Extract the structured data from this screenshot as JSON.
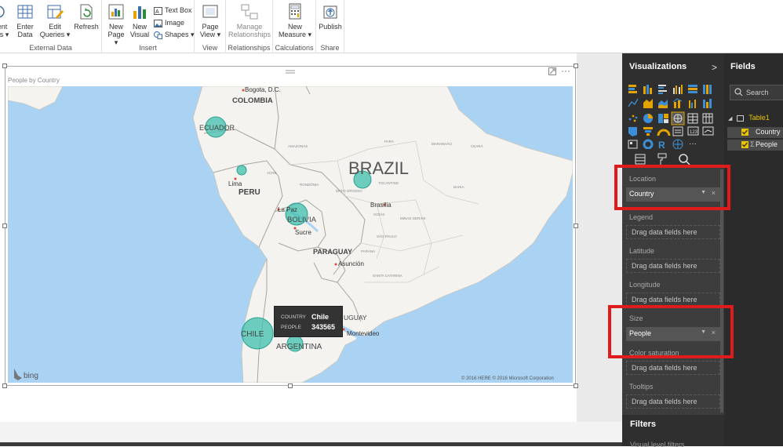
{
  "ribbon": {
    "groups": {
      "external_data": "External Data",
      "insert": "Insert",
      "view": "View",
      "relationships": "Relationships",
      "calculations": "Calculations",
      "share": "Share"
    },
    "buttons": {
      "recent_sources_line1": "ent",
      "recent_sources_line2": "es ▾",
      "enter_data_line1": "Enter",
      "enter_data_line2": "Data",
      "edit_queries_line1": "Edit",
      "edit_queries_line2": "Queries ▾",
      "refresh": "Refresh",
      "new_page_line1": "New",
      "new_page_line2": "Page ▾",
      "new_visual_line1": "New",
      "new_visual_line2": "Visual",
      "text_box": "Text Box",
      "image": "Image",
      "shapes": "Shapes ▾",
      "page_view_line1": "Page",
      "page_view_line2": "View ▾",
      "manage_rel_line1": "Manage",
      "manage_rel_line2": "Relationships",
      "new_measure_line1": "New",
      "new_measure_line2": "Measure ▾",
      "publish": "Publish"
    }
  },
  "visual": {
    "title": "People by Country",
    "more": "···",
    "map": {
      "labels": {
        "bogota": "Bogota, D.C.",
        "colombia": "COLOMBIA",
        "ecuador": "ECUADOR",
        "brazil": "BRAZIL",
        "lima": "Lima",
        "peru": "PERU",
        "lapaz": "La Paz",
        "bolivia": "BOLIVIA",
        "sucre": "Sucre",
        "brasilia": "Brasília",
        "paraguay": "PARAGUAY",
        "asuncion": "Asunción",
        "chile": "CHILE",
        "argentina": "ARGENTINA",
        "montevideo": "Montevideo",
        "uruguay": "UGUAY",
        "amazonas": "AMAZONAS",
        "para": "PARÁ",
        "maranhao": "MARANHÃO",
        "ceara": "CEARÁ",
        "acre": "ACRE",
        "rondonia": "RONDÔNIA",
        "tocantins": "TOCANTINS",
        "mato_grosso": "MATO GROSSO",
        "goias": "GOIÁS",
        "minas": "MINAS GERAIS",
        "sao_paulo": "SÃO PAULO",
        "parana": "PARANÁ",
        "santa_catarina": "SANTA CATARINA",
        "bahia": "BAHIA"
      },
      "bing": "bing",
      "copyright": "© 2016 HERE   © 2016 Microsoft Corporation",
      "tooltip": {
        "country_label": "COUNTRY",
        "country_value": "Chile",
        "people_label": "PEOPLE",
        "people_value": "343565"
      }
    }
  },
  "visualizations": {
    "header": "Visualizations",
    "chevron": ">",
    "wells": {
      "location_label": "Location",
      "location_value": "Country",
      "legend_label": "Legend",
      "latitude_label": "Latitude",
      "longitude_label": "Longitude",
      "size_label": "Size",
      "size_value": "People",
      "color_label": "Color saturation",
      "tooltips_label": "Tooltips",
      "placeholder": "Drag data fields here"
    },
    "filters": {
      "title": "Filters",
      "sub": "Visual level filters"
    }
  },
  "fields": {
    "header": "Fields",
    "search_placeholder": "Search",
    "table_name": "Table1",
    "items": [
      "Country",
      "People"
    ]
  },
  "colors": {
    "accent_yellow": "#e8c400",
    "bubble": "#3fbfad",
    "highlight_red": "#e01b1b",
    "pane_dark": "#2f2f2f"
  }
}
